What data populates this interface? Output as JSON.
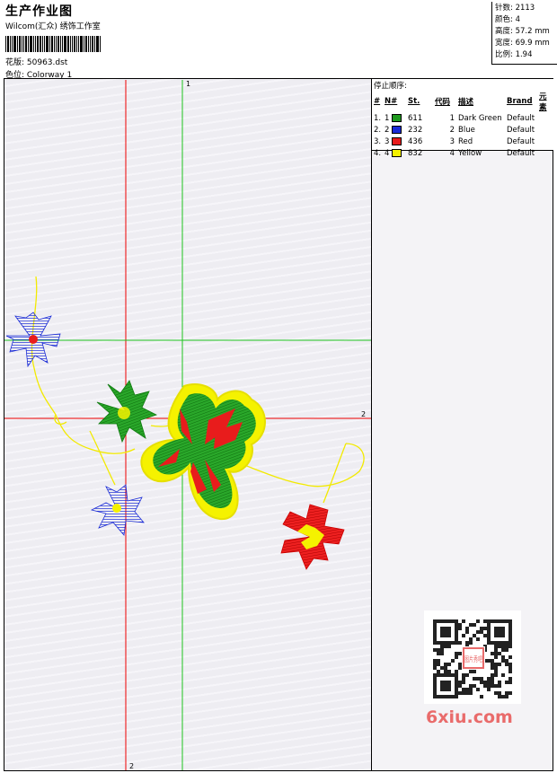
{
  "header": {
    "title": "生产作业图",
    "company": "Wilcom(汇众) 绣饰工作室",
    "pattern": "花版: 50963.dst",
    "colorway": "色位: Colorway 1"
  },
  "stats": {
    "stitches": "针数: 2113",
    "colors": "颜色: 4",
    "height": "高度: 57.2 mm",
    "width": "宽度: 69.9 mm",
    "ratio": "比例: 1.94"
  },
  "stops": {
    "title": "停止顺序:",
    "headers": [
      "#",
      "N#",
      "St.",
      "代码",
      "描述",
      "Brand",
      "元素"
    ],
    "rows": [
      {
        "idx": "1.",
        "n": "1",
        "color": "#1f9a1f",
        "st": "611",
        "code": "1",
        "desc": "Dark Green",
        "brand": "Default"
      },
      {
        "idx": "2.",
        "n": "2",
        "color": "#1a2bd6",
        "st": "232",
        "code": "2",
        "desc": "Blue",
        "brand": "Default"
      },
      {
        "idx": "3.",
        "n": "3",
        "color": "#e81c1c",
        "st": "436",
        "code": "3",
        "desc": "Red",
        "brand": "Default"
      },
      {
        "idx": "4.",
        "n": "4",
        "color": "#f5f200",
        "st": "832",
        "code": "4",
        "desc": "Yellow",
        "brand": "Default"
      }
    ]
  },
  "axes": {
    "green_top": "1",
    "red_right": "2",
    "red_bottom": "2"
  },
  "watermark": "6xiu.com",
  "qr_stamp": "图片秀吧"
}
